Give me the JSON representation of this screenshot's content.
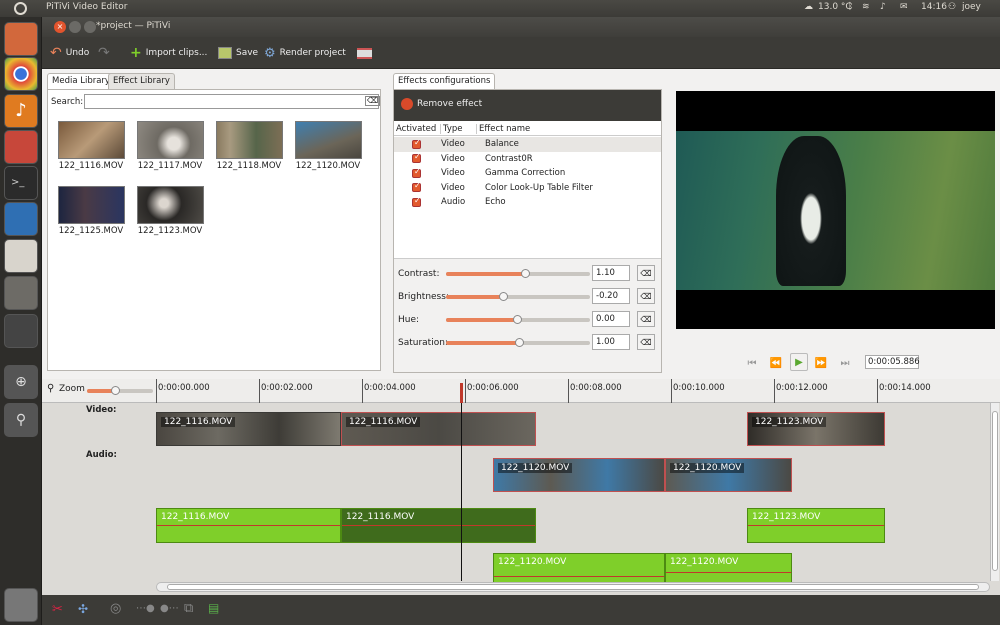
{
  "system_bar": {
    "app_name": "PiTiVi Video Editor",
    "temperature": "13.0 °C",
    "time": "14:16",
    "user": "joey"
  },
  "window": {
    "title": "*project — PiTiVi"
  },
  "toolbar": {
    "undo_label": "Undo",
    "import_label": "Import clips...",
    "save_label": "Save",
    "render_label": "Render project"
  },
  "library": {
    "tabs": [
      "Media Library",
      "Effect Library"
    ],
    "search_label": "Search:",
    "search_value": "",
    "clips": [
      "122_1116.MOV",
      "122_1117.MOV",
      "122_1118.MOV",
      "122_1120.MOV",
      "122_1125.MOV",
      "122_1123.MOV"
    ]
  },
  "effects": {
    "tab": "Effects configurations",
    "remove_label": "Remove effect",
    "columns": [
      "Activated",
      "Type",
      "Effect name"
    ],
    "rows": [
      {
        "type": "Video",
        "name": "Balance"
      },
      {
        "type": "Video",
        "name": "Contrast0R"
      },
      {
        "type": "Video",
        "name": "Gamma Correction"
      },
      {
        "type": "Video",
        "name": "Color Look-Up Table Filter"
      },
      {
        "type": "Audio",
        "name": "Echo"
      }
    ],
    "params": [
      {
        "label": "Contrast:",
        "value": "1.10",
        "level": 0.55
      },
      {
        "label": "Brightness:",
        "value": "-0.20",
        "level": 0.4
      },
      {
        "label": "Hue:",
        "value": "0.00",
        "level": 0.5
      },
      {
        "label": "Saturation:",
        "value": "1.00",
        "level": 0.5
      }
    ]
  },
  "viewer": {
    "timecode": "0:00:05.886"
  },
  "timeline": {
    "zoom_label": "Zoom",
    "ruler": [
      "0:00:00.000",
      "0:00:02.000",
      "0:00:04.000",
      "0:00:06.000",
      "0:00:08.000",
      "0:00:10.000",
      "0:00:12.000",
      "0:00:14.000"
    ],
    "video_label": "Video:",
    "audio_label": "Audio:",
    "video_clips": [
      "122_1116.MOV",
      "122_1116.MOV",
      "122_1123.MOV"
    ],
    "audio_clips_row1": [
      "122_1120.MOV",
      "122_1120.MOV"
    ],
    "audio_clips_row2": [
      "122_1116.MOV",
      "122_1116.MOV",
      "122_1123.MOV"
    ],
    "audio_clips_row3": [
      "122_1120.MOV",
      "122_1120.MOV"
    ]
  },
  "colors": {
    "accent": "#e8825a",
    "audio_green": "#7fcf2a",
    "dark_panel": "#3c3b37"
  }
}
